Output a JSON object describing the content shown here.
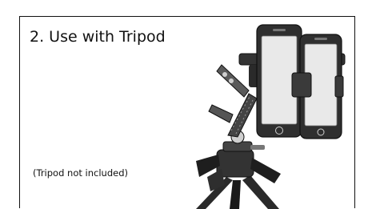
{
  "slide": {
    "title": "2. Use with Tripod",
    "note": "(Tripod not included)"
  },
  "illustration": {
    "subject": "phone-mount-on-tripod",
    "colors": {
      "outline": "#111111",
      "dark": "#2a2a2a",
      "mid": "#777777",
      "light": "#cfcfcf",
      "screen": "#e9e9e9"
    }
  }
}
